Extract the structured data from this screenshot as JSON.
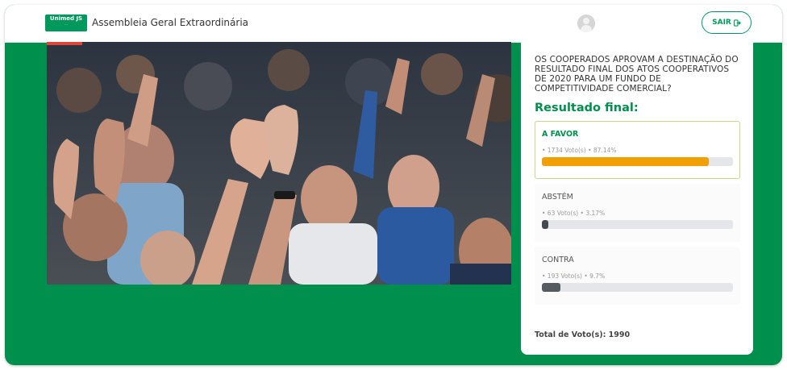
{
  "header": {
    "logo_text": "Unimed JS",
    "logo_sub": "...",
    "title": "Assembleia Geral Extraordinária",
    "logout_label": "SAIR"
  },
  "poll": {
    "question": "OS COOPERADOS APROVAM A DESTINAÇÃO DO RESULTADO FINAL DOS ATOS COOPERATIVOS DE 2020 PARA UM FUNDO DE COMPETITIVIDADE COMERCIAL?",
    "result_title": "Resultado final:",
    "options": [
      {
        "label": "A FAVOR",
        "stats": "• 1734 Voto(s) • 87.14%",
        "percent": 87.14,
        "color": "#f0a000",
        "winner": true
      },
      {
        "label": "ABSTÉM",
        "stats": "• 63 Voto(s) • 3.17%",
        "percent": 3.17,
        "color": "#444a52",
        "winner": false
      },
      {
        "label": "CONTRA",
        "stats": "• 193 Voto(s) • 9.7%",
        "percent": 9.7,
        "color": "#555b63",
        "winner": false
      }
    ],
    "total": "Total de Voto(s): 1990"
  },
  "colors": {
    "brand_green": "#008f4c",
    "accent_orange": "#f0a000"
  },
  "icons": {
    "avatar": "user-avatar-icon",
    "logout": "logout-icon"
  }
}
